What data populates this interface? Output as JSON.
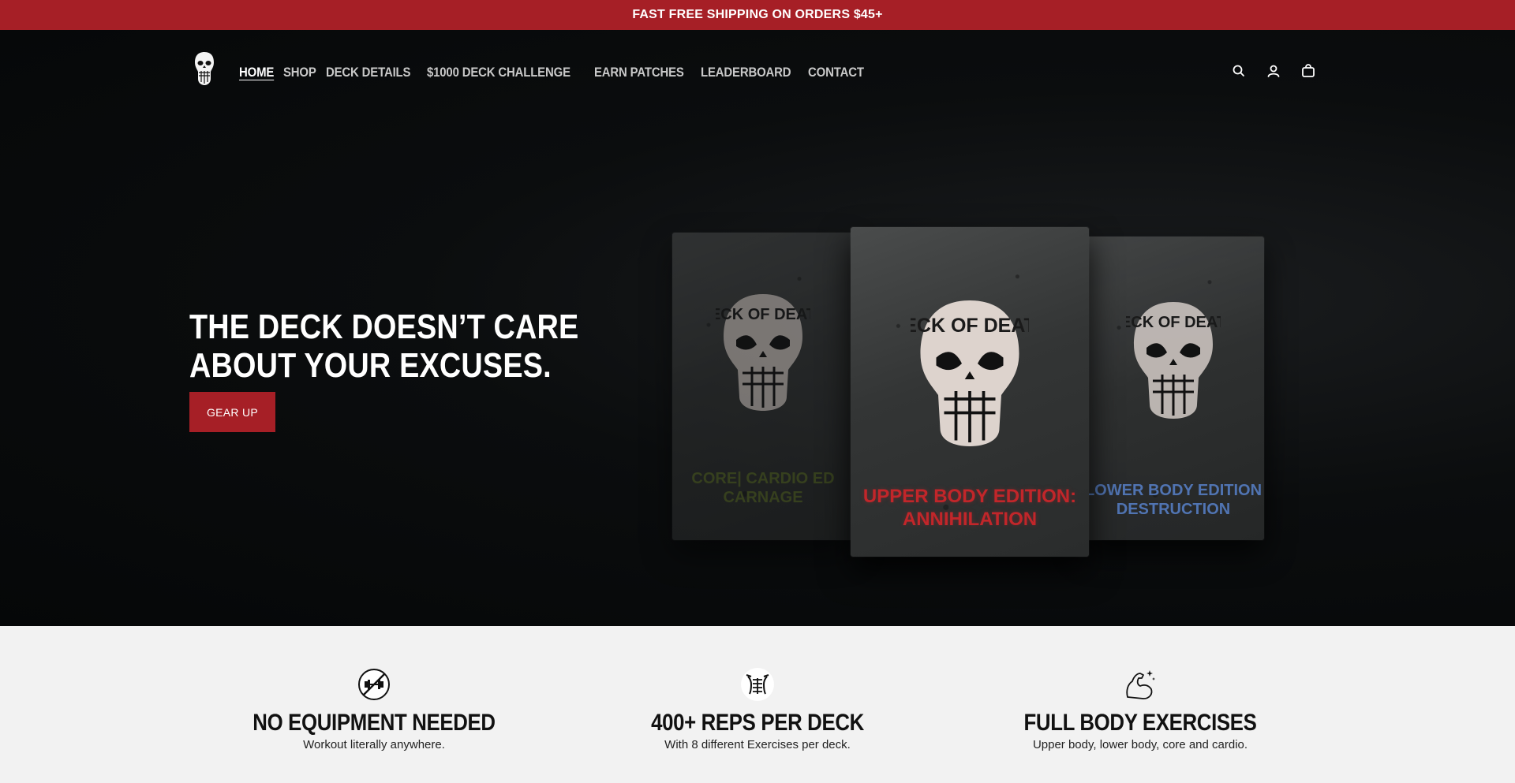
{
  "announcement": "FAST FREE SHIPPING ON ORDERS $45+",
  "nav": {
    "items": [
      {
        "label": "HOME"
      },
      {
        "label": "SHOP"
      },
      {
        "label": "DECK DETAILS"
      },
      {
        "label": "$1000 DECK CHALLENGE"
      },
      {
        "label": "EARN PATCHES"
      },
      {
        "label": "LEADERBOARD"
      },
      {
        "label": "CONTACT"
      }
    ],
    "icons": [
      "search-icon",
      "account-icon",
      "cart-icon"
    ]
  },
  "hero": {
    "headline_line1": "THE DECK DOESN’T CARE",
    "headline_line2": "ABOUT YOUR EXCUSES.",
    "cta": "GEAR UP",
    "decks": {
      "left": {
        "logo": "DECK OF DEATH",
        "label_line1": "CORE| CARDIO ED",
        "label_line2": "CARNAGE"
      },
      "middle": {
        "logo": "DECK OF DEATH",
        "label_line1": "UPPER BODY EDITION:",
        "label_line2": "ANNIHILATION"
      },
      "right": {
        "logo": "DECK OF DEATH",
        "label_line1": "LOWER BODY EDITION",
        "label_line2": "DESTRUCTION"
      }
    }
  },
  "features": [
    {
      "title": "NO EQUIPMENT NEEDED",
      "text": "Workout literally anywhere.",
      "icon": "no-dumbbell-icon"
    },
    {
      "title": "400+ REPS PER DECK",
      "text": "With 8 different Exercises per deck.",
      "icon": "abs-icon"
    },
    {
      "title": "FULL BODY EXERCISES",
      "text": "Upper body, lower body, core and cardio.",
      "icon": "flexed-arm-icon"
    }
  ],
  "colors": {
    "brand_red": "#a61f26",
    "hero_bg": "#050708",
    "features_bg": "#f2f2f2"
  }
}
